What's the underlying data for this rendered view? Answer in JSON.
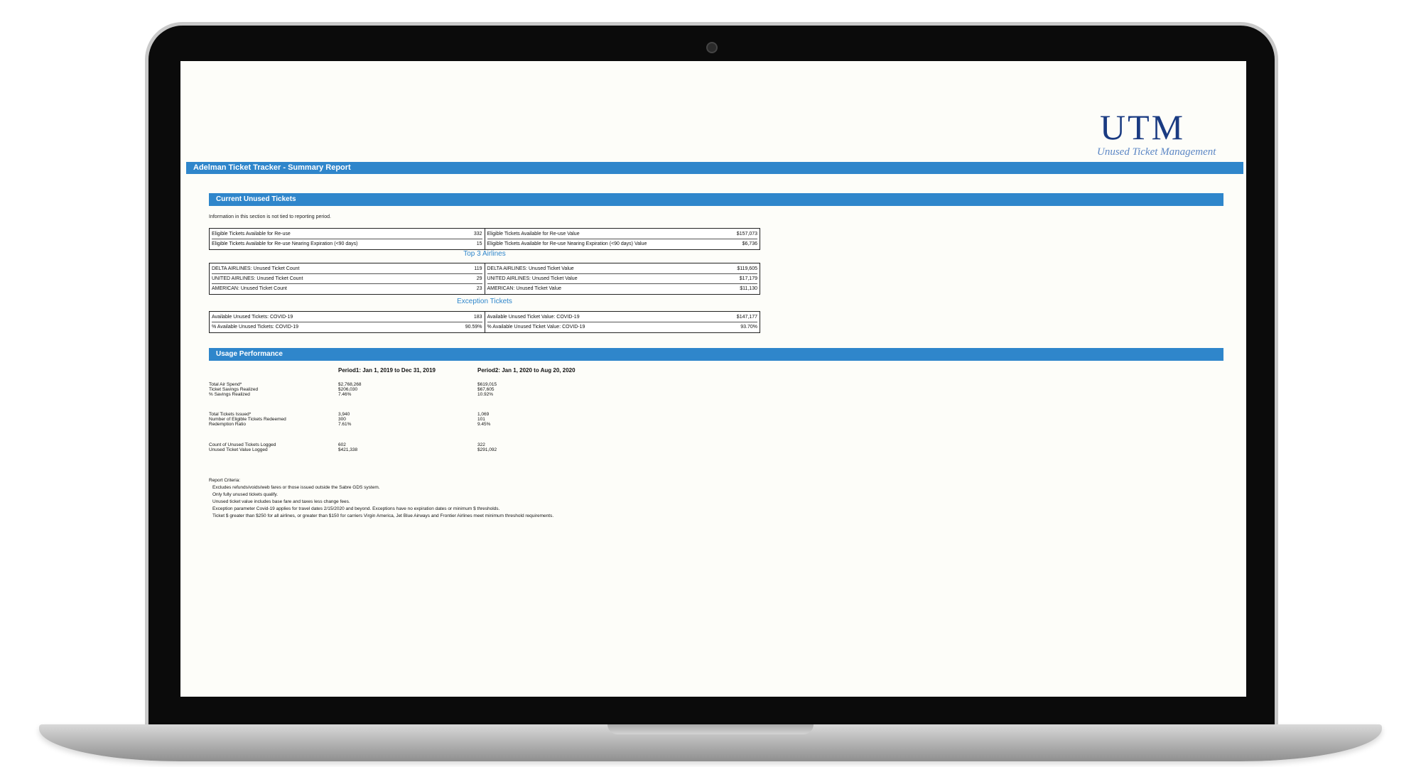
{
  "logo": {
    "main": "UTM",
    "sub": "Unused Ticket Management"
  },
  "report_title": "Adelman Ticket Tracker - Summary Report",
  "current_unused": {
    "heading": "Current Unused Tickets",
    "note": "Information in this section is not tied to reporting period.",
    "eligible": {
      "left": [
        {
          "label": "Eligible Tickets Available for Re-use",
          "value": "332"
        },
        {
          "label": "Eligible Tickets Available for Re-use Nearing Expiration (<90 days)",
          "value": "15"
        }
      ],
      "right": [
        {
          "label": "Eligible Tickets Available for Re-use Value",
          "value": "$157,073"
        },
        {
          "label": "Eligible Tickets Available for Re-use Nearing Expiration (<90 days) Value",
          "value": "$6,736"
        }
      ]
    },
    "top_airlines": {
      "heading": "Top 3 Airlines",
      "left": [
        {
          "label": "DELTA AIRLINES: Unused Ticket Count",
          "value": "119"
        },
        {
          "label": "UNITED AIRLINES: Unused Ticket Count",
          "value": "29"
        },
        {
          "label": "AMERICAN: Unused Ticket Count",
          "value": "23"
        }
      ],
      "right": [
        {
          "label": "DELTA AIRLINES: Unused Ticket Value",
          "value": "$119,605"
        },
        {
          "label": "UNITED AIRLINES: Unused Ticket Value",
          "value": "$17,179"
        },
        {
          "label": "AMERICAN: Unused Ticket Value",
          "value": "$11,130"
        }
      ]
    },
    "exception": {
      "heading": "Exception Tickets",
      "left": [
        {
          "label": "Available Unused Tickets: COVID-19",
          "value": "183"
        },
        {
          "label": "% Available Unused Tickets: COVID-19",
          "value": "90.59%"
        }
      ],
      "right": [
        {
          "label": "Available Unused Ticket Value: COVID-19",
          "value": "$147,177"
        },
        {
          "label": "% Available Unused Ticket Value: COVID-19",
          "value": "93.70%"
        }
      ]
    }
  },
  "usage": {
    "heading": "Usage Performance",
    "period1": "Period1: Jan 1, 2019 to Dec 31, 2019",
    "period2": "Period2: Jan 1, 2020 to Aug 20, 2020",
    "groups": [
      {
        "labels": [
          "Total Air Spend*",
          "Ticket Savings Realized",
          "% Savings Realized"
        ],
        "p1": [
          "$2,768,268",
          "$206,030",
          "7.46%"
        ],
        "p2": [
          "$619,015",
          "$67,605",
          "10.92%"
        ]
      },
      {
        "labels": [
          "Total Tickets Issued*",
          "Number of Eligible Tickets Redeemed",
          "Redemption Ratio"
        ],
        "p1": [
          "3,940",
          "300",
          "7.61%"
        ],
        "p2": [
          "1,069",
          "101",
          "9.45%"
        ]
      },
      {
        "labels": [
          "Count of Unused Tickets Logged",
          "Unused Ticket Value Logged"
        ],
        "p1": [
          "602",
          "$421,338"
        ],
        "p2": [
          "322",
          "$291,092"
        ]
      }
    ]
  },
  "criteria": {
    "heading": "Report Criteria:",
    "items": [
      "Excludes refunds/voids/web fares or those issued outside the Sabre GDS system.",
      "Only fully unused tickets qualify.",
      "Unused ticket value includes base fare and taxes less change fees.",
      "Exception parameter Covid-19 applies for travel dates 2/15/2020 and beyond. Exceptions have no expiration dates or minimum $ thresholds.",
      "Ticket $ greater than $250 for all airlines, or greater than $150 for carriers Virgin America, Jet Blue Airways and Frontier Airlines meet minimum threshold requirements."
    ]
  },
  "colors": {
    "accent": "#2f86cb",
    "logo": "#1a3b82"
  }
}
